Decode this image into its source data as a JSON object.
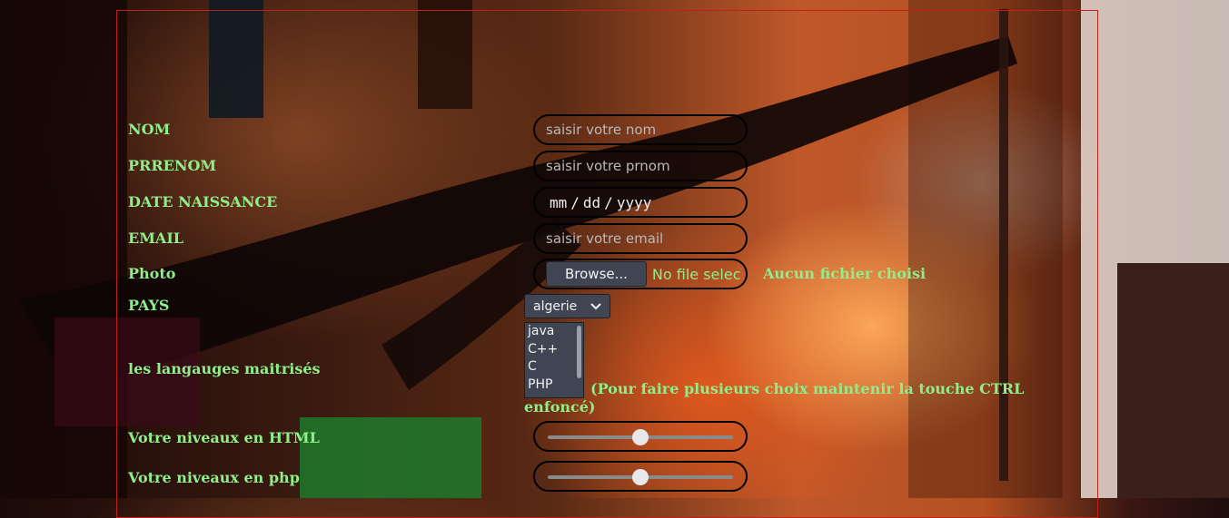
{
  "form": {
    "nom": {
      "label": "NOM",
      "placeholder": "saisir votre nom"
    },
    "prenom": {
      "label": "PRRENOM",
      "placeholder": "saisir votre prnom"
    },
    "date": {
      "label": "DATE NAISSANCE",
      "mm": "mm",
      "dd": "dd",
      "yyyy": "yyyy",
      "sep": "/"
    },
    "email": {
      "label": "EMAIL",
      "placeholder": "saisir votre email"
    },
    "photo": {
      "label": "Photo",
      "browse_label": "Browse...",
      "file_status": "No file selec",
      "aucun_text": "Aucun fichier choisi"
    },
    "pays": {
      "label": "PAYS",
      "selected": "algerie"
    },
    "langages": {
      "label": "les langauges maitrisés",
      "options": [
        "java",
        "C++",
        "C",
        "PHP"
      ],
      "hint": "(Pour faire plusieurs choix maintenir la touche CTRL enfoncé)"
    },
    "niveau_html": {
      "label": "Votre niveaux en HTML",
      "value": 0.5
    },
    "niveau_php": {
      "label": "Votre niveaux en php",
      "value": 0.5
    }
  },
  "colors": {
    "label": "#8fee8a",
    "frame": "#c0201a",
    "control": "#3f4553"
  },
  "icons": {
    "select_arrow": "chevron-down-icon"
  }
}
